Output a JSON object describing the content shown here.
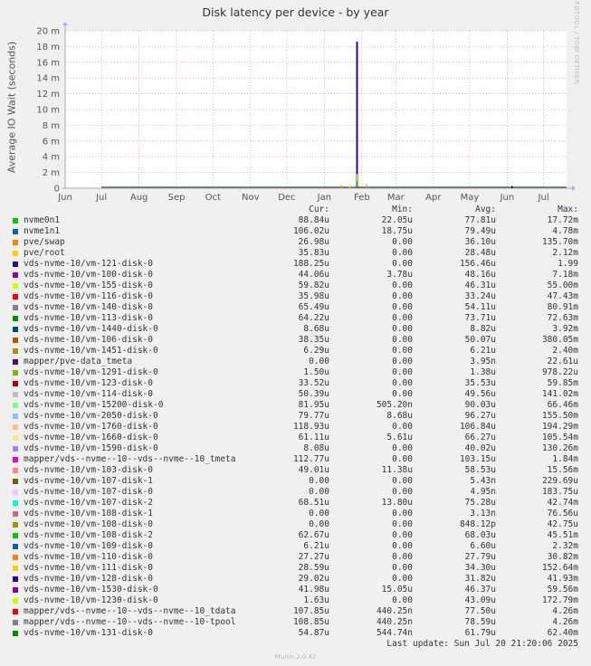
{
  "chart_data": {
    "type": "line",
    "title": "Disk latency per device - by year",
    "ylabel": "Average IO Wait (seconds)",
    "ylim": [
      0,
      0.02
    ],
    "yticks": [
      0,
      0.002,
      0.004,
      0.006,
      0.008,
      0.01,
      0.012,
      0.014,
      0.016,
      0.018,
      0.02
    ],
    "ytick_labels": [
      "0",
      "2 m",
      "4 m",
      "6 m",
      "8 m",
      "10 m",
      "12 m",
      "14 m",
      "16 m",
      "18 m",
      "20 m"
    ],
    "xtick_labels": [
      "Jun",
      "Jul",
      "Aug",
      "Sep",
      "Oct",
      "Nov",
      "Dec",
      "Jan",
      "Feb",
      "Mar",
      "Apr",
      "May",
      "Jun",
      "Jul"
    ],
    "xlim": [
      "2024-06-01",
      "2025-07-20"
    ],
    "grid": true,
    "baseline_start": "2024-07-01",
    "spikes": [
      {
        "date": "2025-01-28",
        "value": 0.0186,
        "color": "#330099"
      },
      {
        "date": "2025-01-28",
        "value": 0.0018,
        "color": "#CCFF00"
      },
      {
        "date": "2025-01-28",
        "value": 0.0009,
        "color": "#00CC00"
      },
      {
        "date": "2025-02-05",
        "value": 0.0005,
        "color": "#FF8000"
      },
      {
        "date": "2025-01-15",
        "value": 0.0004,
        "color": "#FF8000"
      },
      {
        "date": "2025-01-22",
        "value": 0.0004,
        "color": "#FFCC00"
      },
      {
        "date": "2025-06-05",
        "value": 0.0003,
        "color": "#000000"
      }
    ]
  },
  "side_text": "RRDTOOL / TOBI OETIKER",
  "legend": {
    "headers": {
      "cur": "Cur:",
      "min": "Min:",
      "avg": "Avg:",
      "max": "Max:"
    },
    "rows": [
      {
        "name": "nvme0n1",
        "color": "#00CC00",
        "cur": "88.84u",
        "min": "22.05u",
        "avg": "77.81u",
        "max": "17.72m"
      },
      {
        "name": "nvme1n1",
        "color": "#0066B3",
        "cur": "106.02u",
        "min": "18.75u",
        "avg": "79.49u",
        "max": "4.78m"
      },
      {
        "name": "pve/swap",
        "color": "#FF8000",
        "cur": "26.98u",
        "min": "0.00",
        "avg": "36.10u",
        "max": "135.70m"
      },
      {
        "name": "pve/root",
        "color": "#FFCC00",
        "cur": "35.83u",
        "min": "0.00",
        "avg": "28.48u",
        "max": "2.12m"
      },
      {
        "name": "vds-nvme-10/vm-121-disk-0",
        "color": "#330099",
        "cur": "188.25u",
        "min": "0.00",
        "avg": "156.46u",
        "max": "1.99"
      },
      {
        "name": "vds-nvme-10/vm-100-disk-0",
        "color": "#990099",
        "cur": "44.06u",
        "min": "3.78u",
        "avg": "48.16u",
        "max": "7.18m"
      },
      {
        "name": "vds-nvme-10/vm-155-disk-0",
        "color": "#CCFF00",
        "cur": "59.82u",
        "min": "0.00",
        "avg": "46.31u",
        "max": "55.00m"
      },
      {
        "name": "vds-nvme-10/vm-116-disk-0",
        "color": "#FF0000",
        "cur": "35.98u",
        "min": "0.00",
        "avg": "33.24u",
        "max": "47.43m"
      },
      {
        "name": "vds-nvme-10/vm-140-disk-0",
        "color": "#808080",
        "cur": "65.49u",
        "min": "0.00",
        "avg": "54.11u",
        "max": "80.91m"
      },
      {
        "name": "vds-nvme-10/vm-113-disk-0",
        "color": "#008F00",
        "cur": "64.22u",
        "min": "0.00",
        "avg": "73.71u",
        "max": "72.63m"
      },
      {
        "name": "vds-nvme-10/vm-1440-disk-0",
        "color": "#00487D",
        "cur": "8.68u",
        "min": "0.00",
        "avg": "8.82u",
        "max": "3.92m"
      },
      {
        "name": "vds-nvme-10/vm-106-disk-0",
        "color": "#B35A00",
        "cur": "38.35u",
        "min": "0.00",
        "avg": "50.07u",
        "max": "380.05m"
      },
      {
        "name": "vds-nvme-10/vm-1451-disk-0",
        "color": "#B38F00",
        "cur": "6.29u",
        "min": "0.00",
        "avg": "6.21u",
        "max": "2.40m"
      },
      {
        "name": "mapper/pve-data_tmeta",
        "color": "#6B006B",
        "cur": "0.00",
        "min": "0.00",
        "avg": "3.95n",
        "max": "22.61u"
      },
      {
        "name": "vds-nvme-10/vm-1291-disk-0",
        "color": "#8FB300",
        "cur": "1.50u",
        "min": "0.00",
        "avg": "1.38u",
        "max": "978.22u"
      },
      {
        "name": "vds-nvme-10/vm-123-disk-0",
        "color": "#B30000",
        "cur": "33.52u",
        "min": "0.00",
        "avg": "35.53u",
        "max": "59.85m"
      },
      {
        "name": "vds-nvme-10/vm-114-disk-0",
        "color": "#BEBEBE",
        "cur": "50.39u",
        "min": "0.00",
        "avg": "49.56u",
        "max": "141.02m"
      },
      {
        "name": "vds-nvme-10/vm-15200-disk-0",
        "color": "#80FF80",
        "cur": "81.95u",
        "min": "505.20n",
        "avg": "90.03u",
        "max": "66.46m"
      },
      {
        "name": "vds-nvme-10/vm-2050-disk-0",
        "color": "#80C9FF",
        "cur": "79.77u",
        "min": "8.68u",
        "avg": "96.27u",
        "max": "155.50m"
      },
      {
        "name": "vds-nvme-10/vm-1760-disk-0",
        "color": "#FFC080",
        "cur": "118.93u",
        "min": "0.00",
        "avg": "106.84u",
        "max": "194.29m"
      },
      {
        "name": "vds-nvme-10/vm-1660-disk-0",
        "color": "#FFE680",
        "cur": "61.11u",
        "min": "5.61u",
        "avg": "66.27u",
        "max": "105.54m"
      },
      {
        "name": "vds-nvme-10/vm-1590-disk-0",
        "color": "#AA80FF",
        "cur": "8.08u",
        "min": "0.00",
        "avg": "40.02u",
        "max": "130.26m"
      },
      {
        "name": "mapper/vds--nvme--10--vds--nvme--10_tmeta",
        "color": "#EE00CC",
        "cur": "112.77u",
        "min": "0.00",
        "avg": "103.15u",
        "max": "1.84m"
      },
      {
        "name": "vds-nvme-10/vm-103-disk-0",
        "color": "#FF8080",
        "cur": "49.01u",
        "min": "11.38u",
        "avg": "58.53u",
        "max": "15.56m"
      },
      {
        "name": "vds-nvme-10/vm-107-disk-1",
        "color": "#666600",
        "cur": "0.00",
        "min": "0.00",
        "avg": "5.43n",
        "max": "229.69u"
      },
      {
        "name": "vds-nvme-10/vm-107-disk-0",
        "color": "#FFBFFF",
        "cur": "0.00",
        "min": "0.00",
        "avg": "4.95n",
        "max": "183.75u"
      },
      {
        "name": "vds-nvme-10/vm-107-disk-2",
        "color": "#00FFCC",
        "cur": "68.51u",
        "min": "13.80u",
        "avg": "75.28u",
        "max": "42.74m"
      },
      {
        "name": "vds-nvme-10/vm-108-disk-1",
        "color": "#CC6699",
        "cur": "0.00",
        "min": "0.00",
        "avg": "3.13n",
        "max": "76.56u"
      },
      {
        "name": "vds-nvme-10/vm-108-disk-0",
        "color": "#999900",
        "cur": "0.00",
        "min": "0.00",
        "avg": "848.12p",
        "max": "42.75u"
      },
      {
        "name": "vds-nvme-10/vm-108-disk-2",
        "color": "#00CC00",
        "cur": "62.67u",
        "min": "0.00",
        "avg": "68.03u",
        "max": "45.51m"
      },
      {
        "name": "vds-nvme-10/vm-109-disk-0",
        "color": "#0066B3",
        "cur": "6.21u",
        "min": "0.00",
        "avg": "6.60u",
        "max": "2.32m"
      },
      {
        "name": "vds-nvme-10/vm-110-disk-0",
        "color": "#FF8000",
        "cur": "27.27u",
        "min": "0.00",
        "avg": "27.79u",
        "max": "30.82m"
      },
      {
        "name": "vds-nvme-10/vm-111-disk-0",
        "color": "#FFCC00",
        "cur": "28.59u",
        "min": "0.00",
        "avg": "34.30u",
        "max": "152.64m"
      },
      {
        "name": "vds-nvme-10/vm-128-disk-0",
        "color": "#330099",
        "cur": "29.02u",
        "min": "0.00",
        "avg": "31.82u",
        "max": "41.93m"
      },
      {
        "name": "vds-nvme-10/vm-1530-disk-0",
        "color": "#990099",
        "cur": "41.98u",
        "min": "15.05u",
        "avg": "46.37u",
        "max": "59.56m"
      },
      {
        "name": "vds-nvme-10/vm-1230-disk-0",
        "color": "#CCFF00",
        "cur": "1.63u",
        "min": "0.00",
        "avg": "43.09u",
        "max": "172.79m"
      },
      {
        "name": "mapper/vds--nvme--10--vds--nvme--10_tdata",
        "color": "#FF0000",
        "cur": "107.85u",
        "min": "440.25n",
        "avg": "77.50u",
        "max": "4.26m"
      },
      {
        "name": "mapper/vds--nvme--10--vds--nvme--10-tpool",
        "color": "#808080",
        "cur": "108.85u",
        "min": "440.25n",
        "avg": "78.59u",
        "max": "4.26m"
      },
      {
        "name": "vds-nvme-10/vm-131-disk-0",
        "color": "#008F00",
        "cur": "54.87u",
        "min": "544.74n",
        "avg": "61.79u",
        "max": "62.40m"
      }
    ]
  },
  "last_update": "Last update: Sun Jul 20 21:20:06 2025",
  "footer": "Munin 2.0.42"
}
